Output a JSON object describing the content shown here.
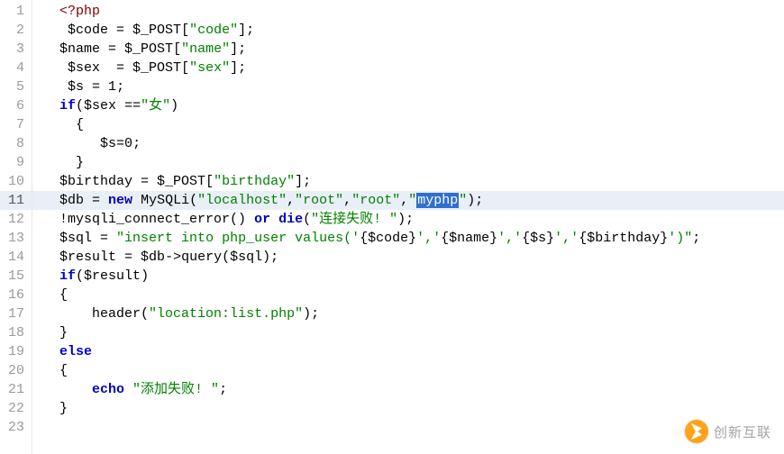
{
  "lines": [
    {
      "n": 1,
      "hl": false,
      "tokens": [
        {
          "t": "  ",
          "c": ""
        },
        {
          "t": "<?php",
          "c": "tok-tag"
        }
      ]
    },
    {
      "n": 2,
      "hl": false,
      "tokens": [
        {
          "t": "   ",
          "c": ""
        },
        {
          "t": "$code",
          "c": "tok-var"
        },
        {
          "t": " = ",
          "c": "tok-punc"
        },
        {
          "t": "$_POST",
          "c": "tok-var"
        },
        {
          "t": "[",
          "c": "tok-punc"
        },
        {
          "t": "\"code\"",
          "c": "tok-str"
        },
        {
          "t": "];",
          "c": "tok-punc"
        }
      ]
    },
    {
      "n": 3,
      "hl": false,
      "tokens": [
        {
          "t": "  ",
          "c": ""
        },
        {
          "t": "$name",
          "c": "tok-var"
        },
        {
          "t": " = ",
          "c": "tok-punc"
        },
        {
          "t": "$_POST",
          "c": "tok-var"
        },
        {
          "t": "[",
          "c": "tok-punc"
        },
        {
          "t": "\"name\"",
          "c": "tok-str"
        },
        {
          "t": "];",
          "c": "tok-punc"
        }
      ]
    },
    {
      "n": 4,
      "hl": false,
      "tokens": [
        {
          "t": "   ",
          "c": ""
        },
        {
          "t": "$sex",
          "c": "tok-var"
        },
        {
          "t": "  = ",
          "c": "tok-punc"
        },
        {
          "t": "$_POST",
          "c": "tok-var"
        },
        {
          "t": "[",
          "c": "tok-punc"
        },
        {
          "t": "\"sex\"",
          "c": "tok-str"
        },
        {
          "t": "];",
          "c": "tok-punc"
        }
      ]
    },
    {
      "n": 5,
      "hl": false,
      "tokens": [
        {
          "t": "   ",
          "c": ""
        },
        {
          "t": "$s",
          "c": "tok-var"
        },
        {
          "t": " = ",
          "c": "tok-punc"
        },
        {
          "t": "1",
          "c": "tok-var"
        },
        {
          "t": ";",
          "c": "tok-punc"
        }
      ]
    },
    {
      "n": 6,
      "hl": false,
      "tokens": [
        {
          "t": "  ",
          "c": ""
        },
        {
          "t": "if",
          "c": "tok-kw"
        },
        {
          "t": "(",
          "c": "tok-punc"
        },
        {
          "t": "$sex",
          "c": "tok-var"
        },
        {
          "t": " ==",
          "c": "tok-punc"
        },
        {
          "t": "\"女\"",
          "c": "tok-str"
        },
        {
          "t": ")",
          "c": "tok-punc"
        }
      ]
    },
    {
      "n": 7,
      "hl": false,
      "tokens": [
        {
          "t": "    {",
          "c": "tok-punc"
        }
      ]
    },
    {
      "n": 8,
      "hl": false,
      "tokens": [
        {
          "t": "       ",
          "c": ""
        },
        {
          "t": "$s",
          "c": "tok-var"
        },
        {
          "t": "=",
          "c": "tok-punc"
        },
        {
          "t": "0",
          "c": "tok-var"
        },
        {
          "t": ";",
          "c": "tok-punc"
        }
      ]
    },
    {
      "n": 9,
      "hl": false,
      "tokens": [
        {
          "t": "    }",
          "c": "tok-punc"
        }
      ]
    },
    {
      "n": 10,
      "hl": false,
      "tokens": [
        {
          "t": "  ",
          "c": ""
        },
        {
          "t": "$birthday",
          "c": "tok-var"
        },
        {
          "t": " = ",
          "c": "tok-punc"
        },
        {
          "t": "$_POST",
          "c": "tok-var"
        },
        {
          "t": "[",
          "c": "tok-punc"
        },
        {
          "t": "\"birthday\"",
          "c": "tok-str"
        },
        {
          "t": "];",
          "c": "tok-punc"
        }
      ]
    },
    {
      "n": 11,
      "hl": true,
      "tokens": [
        {
          "t": "  ",
          "c": ""
        },
        {
          "t": "$db",
          "c": "tok-var"
        },
        {
          "t": " = ",
          "c": "tok-punc"
        },
        {
          "t": "new",
          "c": "tok-new"
        },
        {
          "t": " ",
          "c": ""
        },
        {
          "t": "MySQLi",
          "c": "tok-type"
        },
        {
          "t": "(",
          "c": "tok-punc"
        },
        {
          "t": "\"localhost\"",
          "c": "tok-str"
        },
        {
          "t": ",",
          "c": "tok-punc"
        },
        {
          "t": "\"root\"",
          "c": "tok-str"
        },
        {
          "t": ",",
          "c": "tok-punc"
        },
        {
          "t": "\"root\"",
          "c": "tok-str"
        },
        {
          "t": ",",
          "c": "tok-punc"
        },
        {
          "t": "\"",
          "c": "tok-str"
        },
        {
          "t": "myphp",
          "c": "sel"
        },
        {
          "t": "\"",
          "c": "tok-str"
        },
        {
          "t": ");",
          "c": "tok-punc"
        }
      ]
    },
    {
      "n": 12,
      "hl": false,
      "tokens": [
        {
          "t": "  !",
          "c": "tok-punc"
        },
        {
          "t": "mysqli_connect_error",
          "c": "tok-func"
        },
        {
          "t": "() ",
          "c": "tok-punc"
        },
        {
          "t": "or",
          "c": "tok-kw"
        },
        {
          "t": " ",
          "c": ""
        },
        {
          "t": "die",
          "c": "tok-kw"
        },
        {
          "t": "(",
          "c": "tok-punc"
        },
        {
          "t": "\"连接失败! \"",
          "c": "tok-str"
        },
        {
          "t": ");",
          "c": "tok-punc"
        }
      ]
    },
    {
      "n": 13,
      "hl": false,
      "tokens": [
        {
          "t": "  ",
          "c": ""
        },
        {
          "t": "$sql",
          "c": "tok-var"
        },
        {
          "t": " = ",
          "c": "tok-punc"
        },
        {
          "t": "\"insert into php_user values('",
          "c": "tok-str"
        },
        {
          "t": "{$code}",
          "c": "tok-var"
        },
        {
          "t": "','",
          "c": "tok-str"
        },
        {
          "t": "{$name}",
          "c": "tok-var"
        },
        {
          "t": "','",
          "c": "tok-str"
        },
        {
          "t": "{$s}",
          "c": "tok-var"
        },
        {
          "t": "','",
          "c": "tok-str"
        },
        {
          "t": "{$birthday}",
          "c": "tok-var"
        },
        {
          "t": "')\"",
          "c": "tok-str"
        },
        {
          "t": ";",
          "c": "tok-punc"
        }
      ]
    },
    {
      "n": 14,
      "hl": false,
      "tokens": [
        {
          "t": "  ",
          "c": ""
        },
        {
          "t": "$result",
          "c": "tok-var"
        },
        {
          "t": " = ",
          "c": "tok-punc"
        },
        {
          "t": "$db",
          "c": "tok-var"
        },
        {
          "t": "->",
          "c": "tok-punc"
        },
        {
          "t": "query",
          "c": "tok-func"
        },
        {
          "t": "(",
          "c": "tok-punc"
        },
        {
          "t": "$sql",
          "c": "tok-var"
        },
        {
          "t": ");",
          "c": "tok-punc"
        }
      ]
    },
    {
      "n": 15,
      "hl": false,
      "tokens": [
        {
          "t": "  ",
          "c": ""
        },
        {
          "t": "if",
          "c": "tok-kw"
        },
        {
          "t": "(",
          "c": "tok-punc"
        },
        {
          "t": "$result",
          "c": "tok-var"
        },
        {
          "t": ")",
          "c": "tok-punc"
        }
      ]
    },
    {
      "n": 16,
      "hl": false,
      "tokens": [
        {
          "t": "  {",
          "c": "tok-punc"
        }
      ]
    },
    {
      "n": 17,
      "hl": false,
      "tokens": [
        {
          "t": "      ",
          "c": ""
        },
        {
          "t": "header",
          "c": "tok-func"
        },
        {
          "t": "(",
          "c": "tok-punc"
        },
        {
          "t": "\"location:list.php\"",
          "c": "tok-str"
        },
        {
          "t": ");",
          "c": "tok-punc"
        }
      ]
    },
    {
      "n": 18,
      "hl": false,
      "tokens": [
        {
          "t": "  }",
          "c": "tok-punc"
        }
      ]
    },
    {
      "n": 19,
      "hl": false,
      "tokens": [
        {
          "t": "  ",
          "c": ""
        },
        {
          "t": "else",
          "c": "tok-kw"
        }
      ]
    },
    {
      "n": 20,
      "hl": false,
      "tokens": [
        {
          "t": "  {",
          "c": "tok-punc"
        }
      ]
    },
    {
      "n": 21,
      "hl": false,
      "tokens": [
        {
          "t": "      ",
          "c": ""
        },
        {
          "t": "echo",
          "c": "tok-kw"
        },
        {
          "t": " ",
          "c": ""
        },
        {
          "t": "\"添加失败! \"",
          "c": "tok-str"
        },
        {
          "t": ";",
          "c": "tok-punc"
        }
      ]
    },
    {
      "n": 22,
      "hl": false,
      "tokens": [
        {
          "t": "  }",
          "c": "tok-punc"
        }
      ]
    },
    {
      "n": 23,
      "hl": false,
      "tokens": []
    }
  ],
  "watermark": "创新互联"
}
